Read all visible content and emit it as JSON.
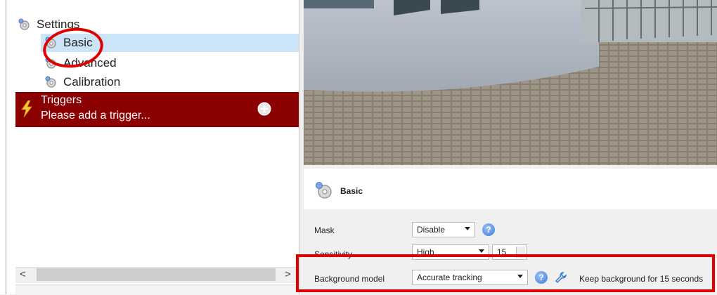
{
  "tree": {
    "settings_label": "Settings",
    "basic_label": "Basic",
    "advanced_label": "Advanced",
    "calibration_label": "Calibration",
    "triggers_title": "Triggers",
    "triggers_subtitle": "Please add a trigger...",
    "scroll_left": "<",
    "scroll_right": ">"
  },
  "panel": {
    "title": "Basic",
    "mask_label": "Mask",
    "mask_value": "Disable",
    "sensitivity_label": "Sensitivity",
    "sensitivity_value": "High",
    "sensitivity_number": "15",
    "background_label": "Background model",
    "background_value": "Accurate tracking",
    "keep_background_text": "Keep background for 15 seconds"
  },
  "colors": {
    "accent_red": "#e00000",
    "trigger_bg": "#8b0000",
    "selection": "#cce4f7"
  },
  "icons": [
    "gear-icon",
    "lightning-icon",
    "add-icon",
    "help-icon",
    "wrench-icon"
  ]
}
